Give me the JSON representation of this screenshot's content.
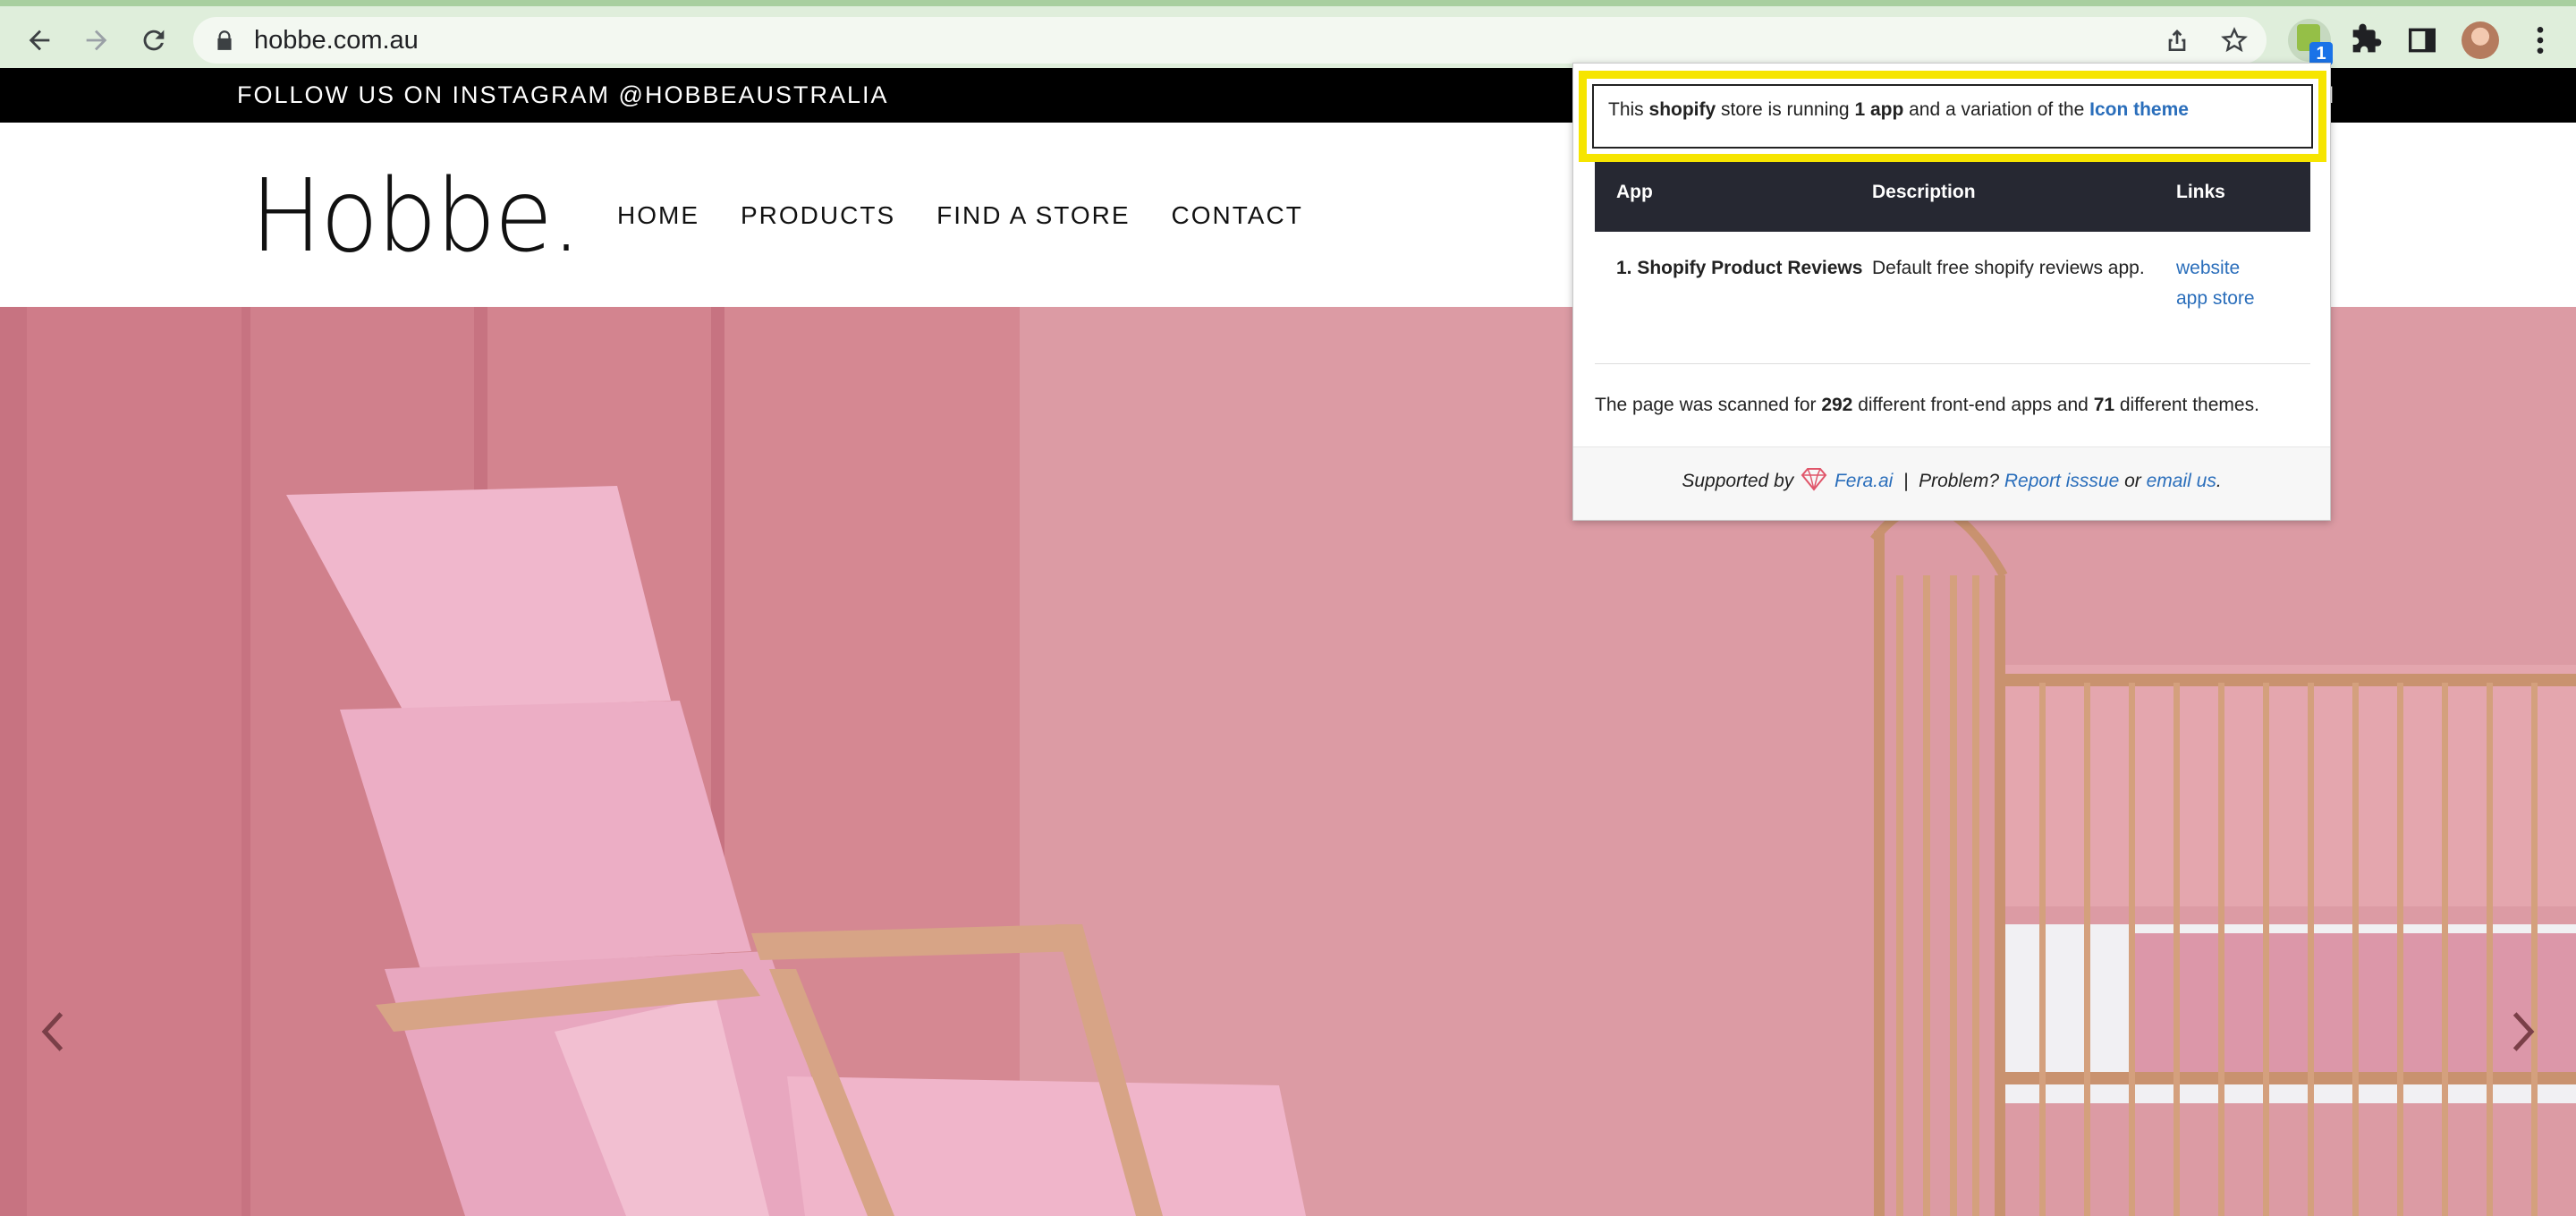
{
  "browser": {
    "url": "hobbe.com.au",
    "extension_badge": "1"
  },
  "site": {
    "topbar_text": "FOLLOW US ON INSTAGRAM @HOBBEAUSTRALIA",
    "topbar_right": "N",
    "logo": "Hobbe.",
    "nav": [
      "HOME",
      "PRODUCTS",
      "FIND A STORE",
      "CONTACT"
    ]
  },
  "popup": {
    "summary": {
      "prefix": "This ",
      "platform": "shopify",
      "middle": " store is running ",
      "app_count": "1 app",
      "suffix": " and a variation of the ",
      "theme": "Icon theme"
    },
    "table": {
      "headers": [
        "App",
        "Description",
        "Links"
      ],
      "rows": [
        {
          "app": "1. Shopify Product Reviews",
          "description": "Default free shopify reviews app.",
          "links": [
            "website",
            "app store"
          ]
        }
      ]
    },
    "scan": {
      "prefix": "The page was scanned for ",
      "apps": "292",
      "middle": " different front-end apps and ",
      "themes": "71",
      "suffix": " different themes."
    },
    "footer": {
      "supported_by": "Supported by",
      "fera": "Fera.ai",
      "separator": "|",
      "problem": "Problem?",
      "report": "Report isssue",
      "or": "or",
      "email": "email us",
      "end": "."
    }
  },
  "colors": {
    "chrome": "#dfeedb",
    "highlight": "#f6e500",
    "table_header": "#262832",
    "link": "#2a6ebb",
    "hero_pink": "#dc98a2"
  }
}
